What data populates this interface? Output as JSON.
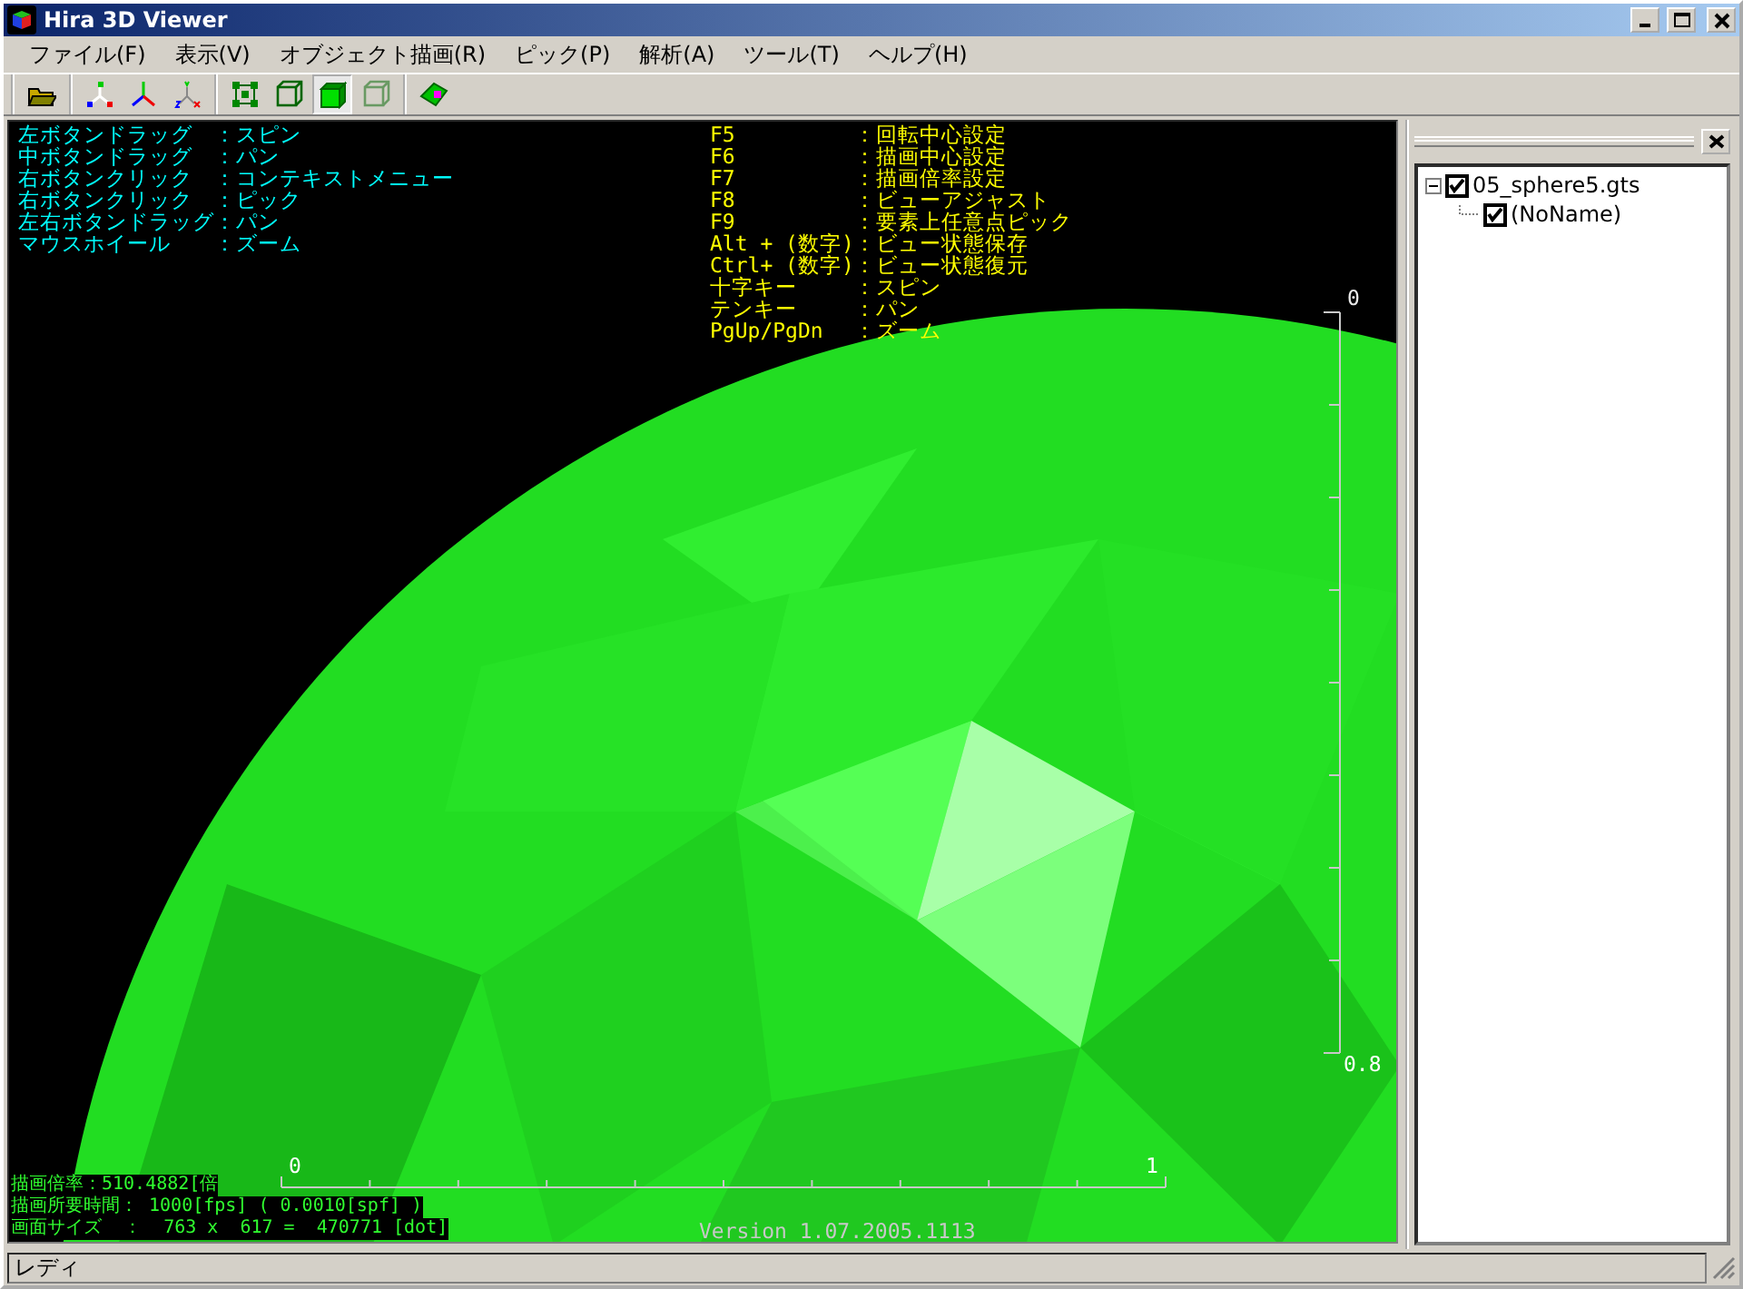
{
  "window": {
    "title": "Hira 3D Viewer"
  },
  "menu": [
    {
      "label": "ファイル(F)"
    },
    {
      "label": "表示(V)"
    },
    {
      "label": "オブジェクト描画(R)"
    },
    {
      "label": "ピック(P)"
    },
    {
      "label": "解析(A)"
    },
    {
      "label": "ツール(T)"
    },
    {
      "label": "ヘルプ(H)"
    }
  ],
  "toolbar_groups": [
    [
      {
        "kind": "open",
        "selected": false,
        "disabled": false
      }
    ],
    [
      {
        "kind": "axes-dots",
        "selected": false,
        "disabled": false
      },
      {
        "kind": "axes-lines",
        "selected": false,
        "disabled": false
      },
      {
        "kind": "axes-xyz",
        "selected": false,
        "disabled": false
      }
    ],
    [
      {
        "kind": "nodes",
        "selected": false,
        "disabled": false
      },
      {
        "kind": "wire",
        "selected": false,
        "disabled": false
      },
      {
        "kind": "solid",
        "selected": true,
        "disabled": false
      },
      {
        "kind": "wire",
        "selected": false,
        "disabled": true
      }
    ],
    [
      {
        "kind": "pick",
        "selected": false,
        "disabled": false
      }
    ]
  ],
  "viewport": {
    "mouse_help": [
      {
        "key": "左ボタンドラッグ",
        "action": "：スピン"
      },
      {
        "key": "中ボタンドラッグ",
        "action": "：パン"
      },
      {
        "key": "右ボタンクリック",
        "action": "：コンテキストメニュー"
      },
      {
        "key": "右ボタンクリック",
        "action": "：ピック"
      },
      {
        "key": "左右ボタンドラッグ",
        "action": "：パン"
      },
      {
        "key": "マウスホイール",
        "action": "：ズーム"
      }
    ],
    "key_help": [
      {
        "key": "F5",
        "action": "：回転中心設定"
      },
      {
        "key": "F6",
        "action": "：描画中心設定"
      },
      {
        "key": "F7",
        "action": "：描画倍率設定"
      },
      {
        "key": "F8",
        "action": "：ビューアジャスト"
      },
      {
        "key": "F9",
        "action": "：要素上任意点ピック"
      },
      {
        "key": "Alt + (数字)",
        "action": "：ビュー状態保存"
      },
      {
        "key": "Ctrl+ (数字)",
        "action": "：ビュー状態復元"
      },
      {
        "key": "十字キー",
        "action": "：スピン"
      },
      {
        "key": "テンキー",
        "action": "：パン"
      },
      {
        "key": "PgUp/PgDn",
        "action": "：ズーム"
      }
    ],
    "vertical_ruler": {
      "start_label": "0",
      "end_label": "0.8"
    },
    "horizontal_ruler": {
      "start_label": "0",
      "end_label": "1"
    },
    "stats": [
      "描画倍率：510.4882[倍",
      "描画所要時間： 1000[fps] ( 0.0010[spf] )",
      "画面サイズ  ：  763 x  617 =  470771 [dot]"
    ],
    "version": "Version 1.07.2005.1113"
  },
  "tree": [
    {
      "label": "05_sphere5.gts",
      "checked": true,
      "expanded": true,
      "children": [
        {
          "label": "(NoName)",
          "checked": true
        }
      ]
    }
  ],
  "status_bar": "レディ"
}
